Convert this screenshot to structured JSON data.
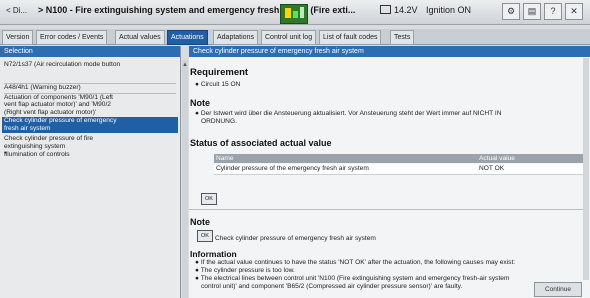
{
  "titlebar": {
    "breadcrumb": "< Di...",
    "title": "> N100 - Fire extinguishing system and emergency fresh air s... (Fire exti...",
    "voltage": "14.2V",
    "ignition": "Ignition ON",
    "icons": [
      "gear-icon",
      "document-icon",
      "question-icon",
      "close-icon"
    ]
  },
  "tabs": [
    {
      "label": "Version"
    },
    {
      "label": "Error codes / Events"
    },
    {
      "label": "Actual values"
    },
    {
      "label": "Actuations"
    },
    {
      "label": "Adaptations"
    },
    {
      "label": "Control unit log"
    },
    {
      "label": "List of fault codes"
    },
    {
      "label": "Tests"
    }
  ],
  "left": {
    "header": "Selection",
    "items": [
      "N72/1s37 (Air recirculation mode button",
      "A48/4h1 (Warning buzzer)",
      "Actuation of components 'M90/1 (Left",
      "vent flap actuator motor)' and 'M90/2",
      "(Right vent flap actuator motor)'",
      "Check cylinder pressure of emergency",
      "fresh air system",
      "Check cylinder pressure of fire",
      "extinguishing system",
      "Illumination of controls"
    ]
  },
  "right": {
    "header": "Check cylinder pressure of emergency fresh air system",
    "requirement_title": "Requirement",
    "requirement_item": "Circuit 15 ON",
    "note_title": "Note",
    "note_line1": "Der Istwert wird über die Ansteuerung aktualisiert. Vor Ansteuerung steht der Wert immer auf NICHT IN",
    "note_line2": "ORDNUNG.",
    "status_title": "Status of associated actual value",
    "table": {
      "col_name": "Name",
      "col_value": "Actual value",
      "row_name": "Cylinder pressure of the emergency fresh air system",
      "row_value": "NOT OK"
    },
    "ok_small": "OK",
    "note2_title": "Note",
    "note2_box": "OK",
    "note2_text": "Check cylinder pressure of emergency fresh air system",
    "info_title": "Information",
    "info_lines": [
      "If the actual value continues to have the status 'NOT OK' after the actuation, the following causes may exist:",
      "The cylinder pressure is too low.",
      "The electrical lines between control unit 'N100 (Fire extinguishing system and emergency fresh-air system",
      "control unit)' and component 'B65/2 (Compressed air cylinder pressure sensor)' are faulty."
    ],
    "continue_button": "Continue"
  }
}
